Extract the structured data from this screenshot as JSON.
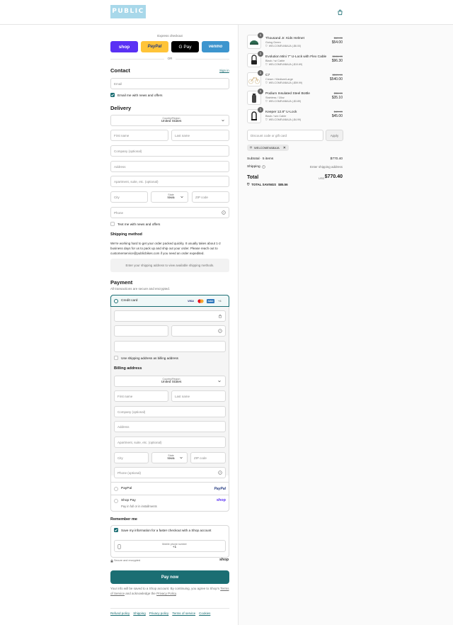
{
  "brand": {
    "logo_text": "PUBLIC",
    "color": "#a8d8ea"
  },
  "header": {
    "cart_icon": "shopping-bag-icon"
  },
  "express": {
    "label": "Express checkout",
    "buttons": [
      {
        "label": "shop",
        "color": "#5a31f4"
      },
      {
        "label": "PayPal",
        "color": "#ffc439"
      },
      {
        "label": "G Pay",
        "color": "#000000"
      },
      {
        "label": "venmo",
        "color": "#3d95ce"
      }
    ],
    "or_label": "OR"
  },
  "contact": {
    "title": "Contact",
    "sign_in": "Sign in",
    "email_placeholder": "Email",
    "email_news_label": "Email me with news and offers"
  },
  "delivery": {
    "title": "Delivery",
    "country_label": "Country/Region",
    "country_value": "United States",
    "first_name": "First name",
    "last_name": "Last name",
    "company": "Company (optional)",
    "address": "Address",
    "apartment": "Apartment, suite, etc. (optional)",
    "city": "City",
    "state_label": "State",
    "state_value": "Iowa",
    "zip": "ZIP code",
    "phone": "Phone",
    "text_news_label": "Text me with news and offers"
  },
  "shipping_method": {
    "title": "Shipping method",
    "note": "We're working hard to get your order packed quickly. It usually takes about 1-2 business days for us to pack up and ship out your order. Please reach out to customerservice@publicbikes.com if you need an order expedited.",
    "placeholder_text": "Enter your shipping address to view available shipping methods."
  },
  "payment": {
    "title": "Payment",
    "subtitle": "All transactions are secure and encrypted.",
    "credit_card_label": "Credit card",
    "card_brands": [
      "VISA",
      "MC",
      "AMEX"
    ],
    "more_cards": "+4",
    "use_shipping_label": "Use shipping address as billing address",
    "billing_title": "Billing address",
    "billing": {
      "country_label": "Country/Region",
      "country_value": "United States",
      "first_name": "First name",
      "last_name": "Last name",
      "company": "Company (optional)",
      "address": "Address",
      "apartment": "Apartment, suite, etc. (optional)",
      "city": "City",
      "state_label": "State",
      "state_value": "Iowa",
      "zip": "ZIP code",
      "phone": "Phone (optional)"
    },
    "paypal_label": "PayPal",
    "paypal_logo": "PayPal",
    "shoppay_label": "Shop Pay",
    "shoppay_sub": "Pay in full or in installments",
    "shoppay_logo": "shop"
  },
  "remember": {
    "title": "Remember me",
    "save_label": "Save my information for a faster checkout with a Shop account",
    "mobile_label": "Mobile phone number",
    "mobile_value": "+1",
    "secure_label": "Secure and encrypted",
    "shop_logo": "shop"
  },
  "pay_now": "Pay now",
  "legal": {
    "text_before": "Your info will be saved to a Shop account. By continuing, you agree to Shop's",
    "terms": "Terms of Service",
    "and_text": "and acknowledge the",
    "privacy": "Privacy Policy",
    "end": "."
  },
  "footer_links": [
    "Refund policy",
    "Shipping",
    "Privacy policy",
    "Terms of service",
    "Cookies"
  ],
  "accent_color": "#1b6e73",
  "cart": {
    "items": [
      {
        "qty": "1",
        "name": "Thousand Jr. Kids Helmet",
        "variant": "Going Green",
        "discount": "WELCOMEVABAJA (-$6.00)",
        "old_price": "$60.00",
        "price": "$54.00"
      },
      {
        "qty": "1",
        "name": "Evolution Mini 7\" U-Lock with Flex Cable",
        "variant": "Black / w/ Cable",
        "discount": "WELCOMEVABAJA (-$10.69)",
        "old_price": "$106.99",
        "price": "$96.30"
      },
      {
        "qty": "1",
        "name": "C7",
        "variant": "Cream / Medium/Large",
        "discount": "WELCOMEVABAJA (-$59.99)",
        "old_price": "$599.99",
        "price": "$540.00"
      },
      {
        "qty": "1",
        "name": "Podium Insulated Steel Bottle",
        "variant": "Stainless / 18oz",
        "discount": "WELCOMEVABAJA (-$3.89)",
        "old_price": "$38.99",
        "price": "$35.10"
      },
      {
        "qty": "1",
        "name": "Keeper 12.8\" U-Lock",
        "variant": "Black / w/o Cable",
        "discount": "WELCOMEVABAJA (-$4.99)",
        "old_price": "$49.99",
        "price": "$45.00"
      }
    ],
    "discount_placeholder": "Discount code or gift card",
    "apply_label": "Apply",
    "applied_code": "WELCOMEVABAJA",
    "subtotal_label": "Subtotal · 5 items",
    "subtotal_value": "$770.40",
    "shipping_label": "Shipping",
    "shipping_value": "Enter shipping address",
    "total_label": "Total",
    "currency": "USD",
    "total_value": "$770.40",
    "savings_label": "TOTAL SAVINGS",
    "savings_value": "$85.56"
  }
}
